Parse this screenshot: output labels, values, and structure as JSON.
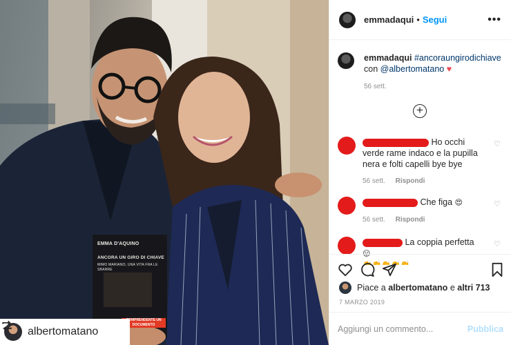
{
  "post": {
    "username": "emmadaqui",
    "follow_label": "Segui",
    "dot": "•",
    "more_label": "•••",
    "caption_user": "emmadaqui",
    "caption_hashtag": "#ancoraungirodichiave",
    "caption_prefix": "con",
    "caption_mention": "@albertomatano",
    "caption_emoji": "♥",
    "caption_time": "56 sett.",
    "load_more_label": "+",
    "regram_name": "albertomatano"
  },
  "book": {
    "author": "EMMA D'AQUINO",
    "title": "ANCORA UN GIRO DI CHIAVE",
    "subtitle": "MIMO MARIANO, UNA VITA FRA LE SBARRE",
    "band": "COMPRENDENTE UN DOCUMENTO"
  },
  "comments": [
    {
      "text": "Ho occhi verde rame indaco e la pupilla nera e folti capelli bye bye",
      "time": "56 sett.",
      "reply": "Rispondi"
    },
    {
      "text": "Che figa",
      "emoji": "😍",
      "time": "56 sett.",
      "reply": "Rispondi"
    },
    {
      "text": "La coppia perfetta",
      "emoji": "😛",
      "emoji_row": "👏👏👏👏👏"
    }
  ],
  "likes": {
    "prefix": "Piace a",
    "user": "albertomatano",
    "conj": "e",
    "others": "altri 713"
  },
  "date": "7 MARZO 2019",
  "comment_box": {
    "placeholder": "Aggiungi un commento...",
    "publish": "Pubblica"
  },
  "colors": {
    "accent": "#0095f6",
    "link": "#00376b",
    "heart": "#ed4956",
    "redaction": "#e31b1b",
    "publish_disabled": "#b2dffc"
  },
  "icons": [
    "heart-icon",
    "comment-icon",
    "share-icon",
    "bookmark-icon",
    "regram-icon",
    "add-circle-icon",
    "small-heart-icon"
  ]
}
